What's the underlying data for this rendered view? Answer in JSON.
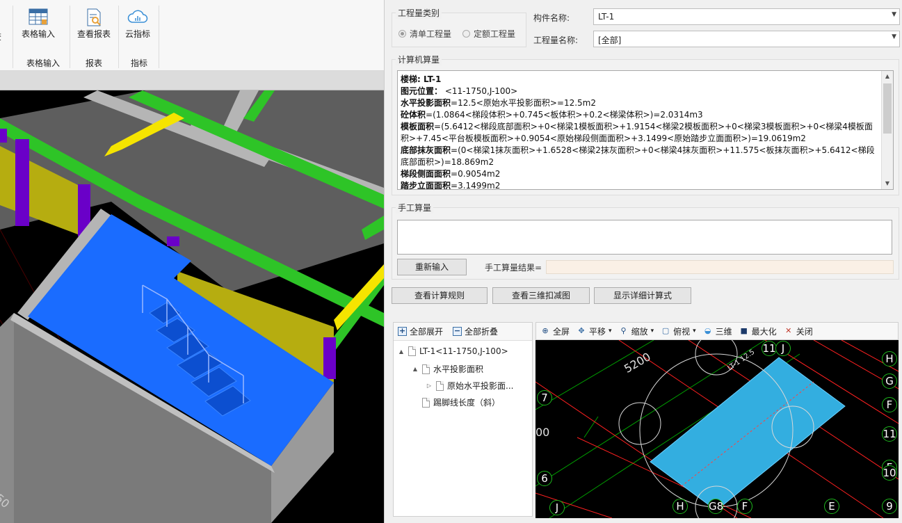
{
  "ribbon": {
    "partial_button": "查",
    "buttons": [
      {
        "label": "表格输入",
        "icon": "table-icon"
      },
      {
        "label": "查看报表",
        "icon": "report-search-icon"
      },
      {
        "label": "云指标",
        "icon": "cloud-icon"
      }
    ],
    "groups": [
      "表格输入",
      "报表",
      "指标"
    ]
  },
  "quantity_type": {
    "legend": "工程量类别",
    "options": [
      "清单工程量",
      "定额工程量"
    ],
    "selected": 0
  },
  "component_name": {
    "label": "构件名称:",
    "value": "LT-1"
  },
  "quantity_name": {
    "label": "工程量名称:",
    "value": "[全部]"
  },
  "calc": {
    "legend": "计算机算量",
    "lines": [
      {
        "key": "楼梯: LT-1",
        "rest": ""
      },
      {
        "key": "图元位置：",
        "rest": " <11-1750,J-100>"
      },
      {
        "key": "水平投影面积",
        "rest": "=12.5<原始水平投影面积>=12.5m2"
      },
      {
        "key": "砼体积",
        "rest": "=(1.0864<梯段体积>+0.745<板体积>+0.2<梯梁体积>)=2.0314m3"
      },
      {
        "key": "模板面积",
        "rest": "=(5.6412<梯段底部面积>+0<梯梁1模板面积>+1.9154<梯梁2模板面积>+0<梯梁3模板面积>+0<梯梁4模板面积>+7.45<平台板模板面积>+0.9054<原始梯段侧面面积>+3.1499<原始踏步立面面积>)=19.0619m2"
      },
      {
        "key": "底部抹灰面积",
        "rest": "=(0<梯梁1抹灰面积>+1.6528<梯梁2抹灰面积>+0<梯梁4抹灰面积>+11.575<板抹灰面积>+5.6412<梯段底部面积>)=18.869m2"
      },
      {
        "key": "梯段侧面面积",
        "rest": "=0.9054m2"
      },
      {
        "key": "踏步立面面积",
        "rest": "=3.1499m2"
      }
    ]
  },
  "manual": {
    "legend": "手工算量",
    "reenter_button": "重新输入",
    "result_label": "手工算量结果="
  },
  "actions": [
    "查看计算规则",
    "查看三维扣减图",
    "显示详细计算式"
  ],
  "tree": {
    "expand_all": "全部展开",
    "collapse_all": "全部折叠",
    "nodes": [
      {
        "label": "LT-1<11-1750,J-100>",
        "level": 0,
        "toggle": "▲"
      },
      {
        "label": "水平投影面积",
        "level": 1,
        "toggle": "▲"
      },
      {
        "label": "原始水平投影面...",
        "level": 2,
        "toggle": "▷"
      },
      {
        "label": "踢脚线长度（斜）",
        "level": 1,
        "toggle": ""
      }
    ]
  },
  "view2d_toolbar": [
    {
      "label": "全屏",
      "icon": "fullscreen-icon",
      "dropdown": false
    },
    {
      "label": "平移",
      "icon": "pan-icon",
      "dropdown": true
    },
    {
      "label": "缩放",
      "icon": "zoom-icon",
      "dropdown": true
    },
    {
      "label": "俯视",
      "icon": "top-view-icon",
      "dropdown": true
    },
    {
      "label": "三维",
      "icon": "3d-icon",
      "dropdown": false
    },
    {
      "label": "最大化",
      "icon": "maximize-icon",
      "dropdown": false
    },
    {
      "label": "关闭",
      "icon": "close-icon",
      "dropdown": false
    }
  ],
  "view2d": {
    "dimension_text": "5200",
    "member_label": "LT-1 12.5",
    "axis_labels_right": [
      "H",
      "G",
      "F",
      "11",
      "F",
      "10",
      "9"
    ],
    "axis_labels_left": [
      "7",
      "6",
      "J"
    ],
    "axis_labels_top": [
      "11",
      "J"
    ],
    "axis_labels_bottom": [
      "H",
      "G8",
      "F",
      "E"
    ],
    "partial_left_text": "00"
  },
  "viewport3d": {
    "partial_dimension_text": "50"
  },
  "colors": {
    "stair_blue": "#1a6cff",
    "beam_green": "#2ec427",
    "column_purple": "#6a00c8",
    "wall_yellow": "#b6ad10",
    "slab_gray": "#5a5a5a",
    "plan_fill": "#33aee0",
    "plan_grid_red": "#ff2020"
  }
}
